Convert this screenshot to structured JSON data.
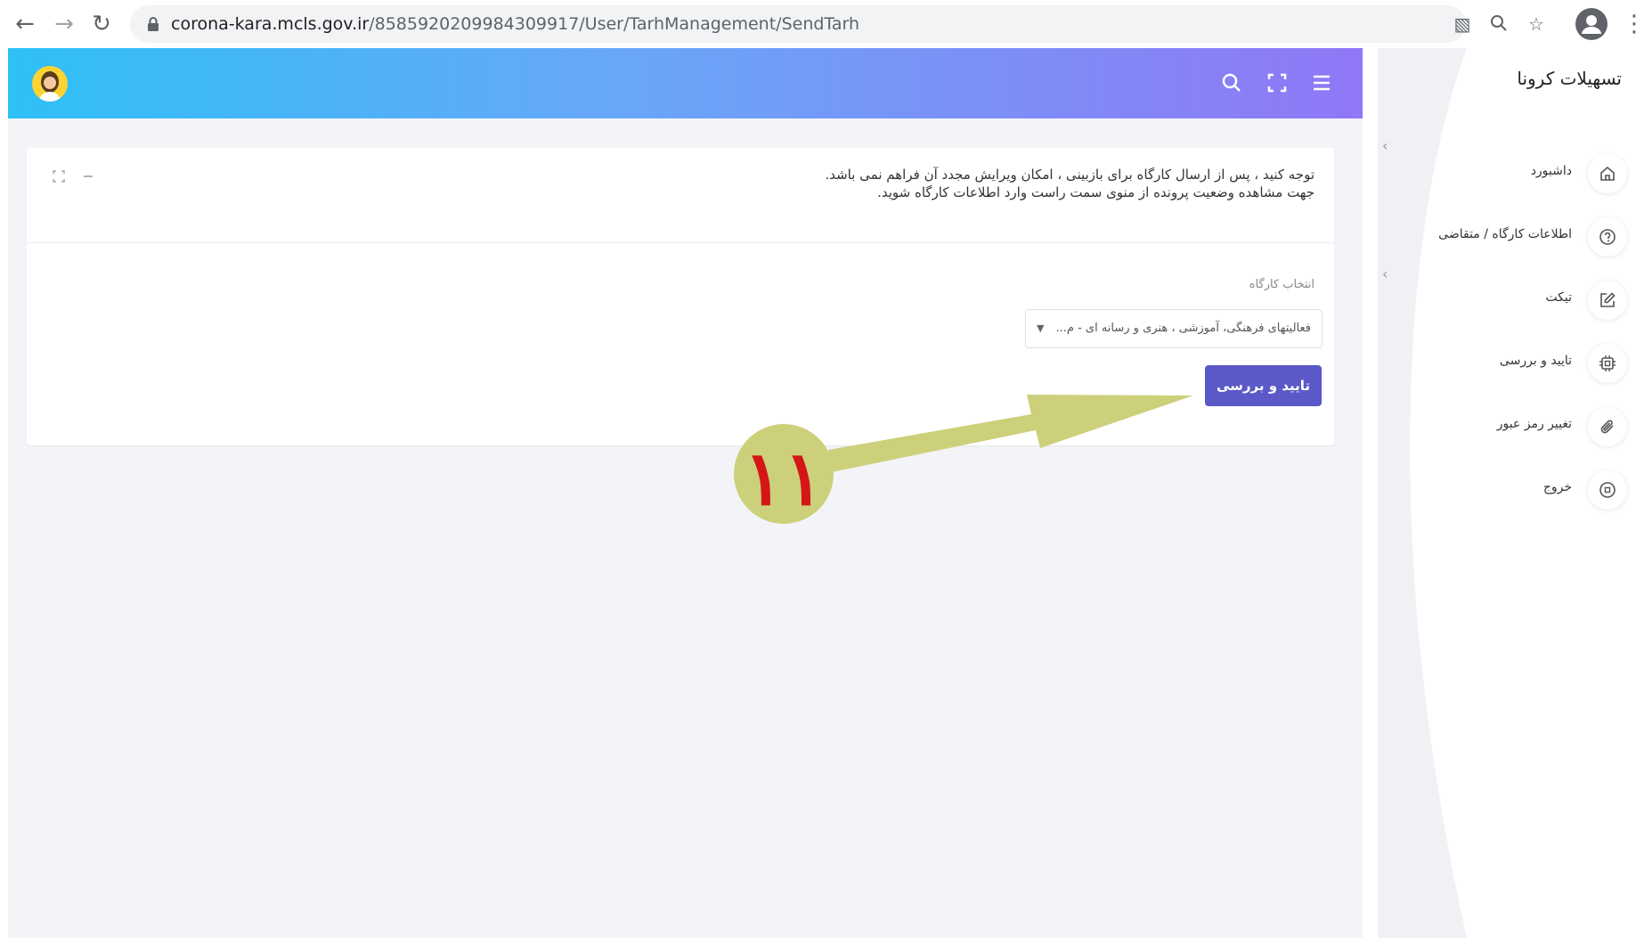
{
  "browser": {
    "url_host": "corona-kara.mcls.gov.ir",
    "url_path": "/8585920209984309917/User/TarhManagement/SendTarh"
  },
  "notice": {
    "line1": "توجه کنید ، پس از ارسال کارگاه برای بازبینی ، امکان ویرایش مجدد آن فراهم نمی باشد.",
    "line2": "جهت مشاهده وضعیت پرونده از منوی سمت راست وارد اطلاعات کارگاه شوید."
  },
  "form": {
    "label": "انتخاب کارگاه",
    "selected": "فعالیتهای فرهنگی، آموزشی ، هنری و رسانه ای - م...",
    "submit_label": "تایید و بررسی"
  },
  "annotation": {
    "number": "۱۱",
    "arrow_color": "#cdd07a"
  },
  "sidebar": {
    "brand": "تسهیلات کرونا",
    "items": [
      {
        "label": "داشبورد",
        "icon": "home-icon"
      },
      {
        "label": "اطلاعات کارگاه / متقاضی",
        "icon": "help-circle-icon"
      },
      {
        "label": "تیکت",
        "icon": "edit-icon"
      },
      {
        "label": "تایید و بررسی",
        "icon": "cpu-icon"
      },
      {
        "label": "تغییر رمز عبور",
        "icon": "paperclip-icon"
      },
      {
        "label": "خروج",
        "icon": "logout-icon"
      }
    ]
  },
  "colors": {
    "topbar_start": "#2ec0f6",
    "topbar_end": "#9077f6",
    "submit_button": "#5b58c7"
  }
}
